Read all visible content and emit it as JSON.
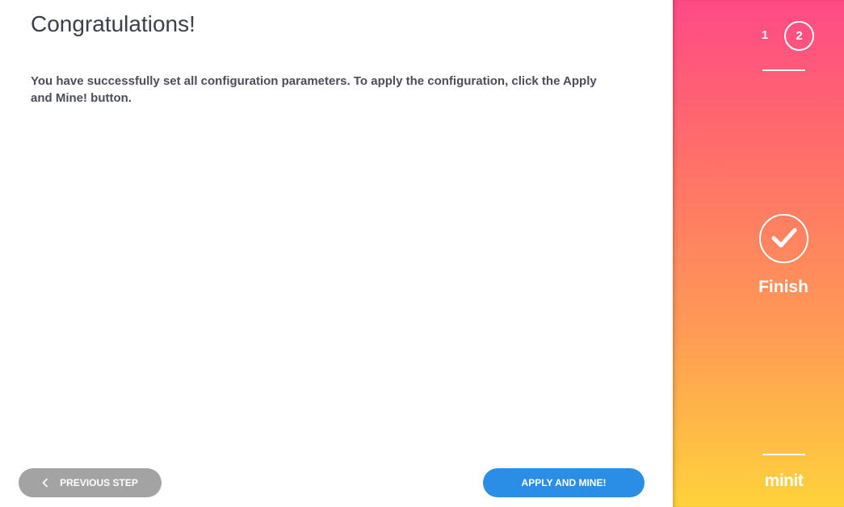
{
  "main": {
    "title": "Congratulations!",
    "message": "You have successfully set all configuration parameters. To apply the configuration, click the Apply and Mine! button."
  },
  "buttons": {
    "previous_label": "PREVIOUS STEP",
    "apply_label": "APPLY AND MINE!"
  },
  "sidebar": {
    "steps": [
      "1",
      "2"
    ],
    "current_step": "2",
    "finish_label": "Finish",
    "logo_text": "minit",
    "icons": {
      "done": "checkmark-icon",
      "back": "chevron-left-icon"
    }
  },
  "colors": {
    "apply_button": "#2b8ee6",
    "previous_button": "#a3a3a3",
    "gradient_top": "#ff4a86",
    "gradient_bottom": "#ffd23b"
  }
}
